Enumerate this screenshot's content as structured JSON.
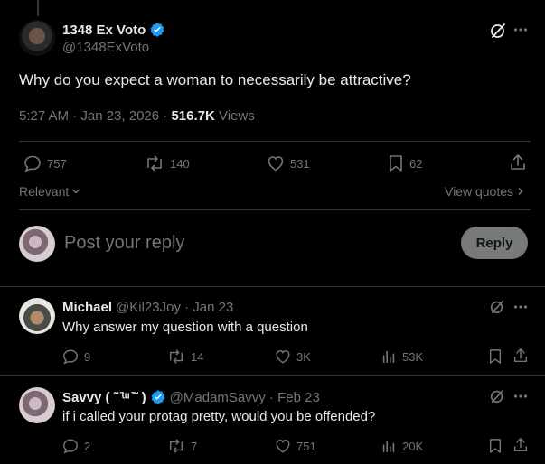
{
  "main_post": {
    "author_name": "1348 Ex Voto",
    "author_handle": "@1348ExVoto",
    "text": "Why do you expect a woman to necessarily be attractive?",
    "timestamp": "5:27 AM · Jan 23, 2026 · ",
    "views_count": "516.7K",
    "views_label": " Views",
    "stats": {
      "replies": "757",
      "reposts": "140",
      "likes": "531",
      "bookmarks": "62"
    }
  },
  "sort": {
    "label": "Relevant"
  },
  "view_quotes_label": "View quotes",
  "composer": {
    "placeholder": "Post your reply",
    "button_label": "Reply"
  },
  "replies": [
    {
      "name": "Michael",
      "handle_date": "@Kil23Joy · Jan 23",
      "text": "Why answer my question with a question",
      "stats": {
        "replies": "9",
        "reposts": "14",
        "likes": "3K",
        "views": "53K"
      }
    },
    {
      "name": "Savvy ( ˜ ̄ᵚ ̄˜ )",
      "handle_date": "@MadamSavvy · Feb 23",
      "text": "if i called your protag pretty, would you be offended?",
      "stats": {
        "replies": "2",
        "reposts": "7",
        "likes": "751",
        "views": "20K"
      }
    }
  ],
  "colors": {
    "background": "#000000",
    "text": "#e7e9ea",
    "muted": "#71767b",
    "verified": "#1d9bf0",
    "divider": "#2f3336"
  }
}
